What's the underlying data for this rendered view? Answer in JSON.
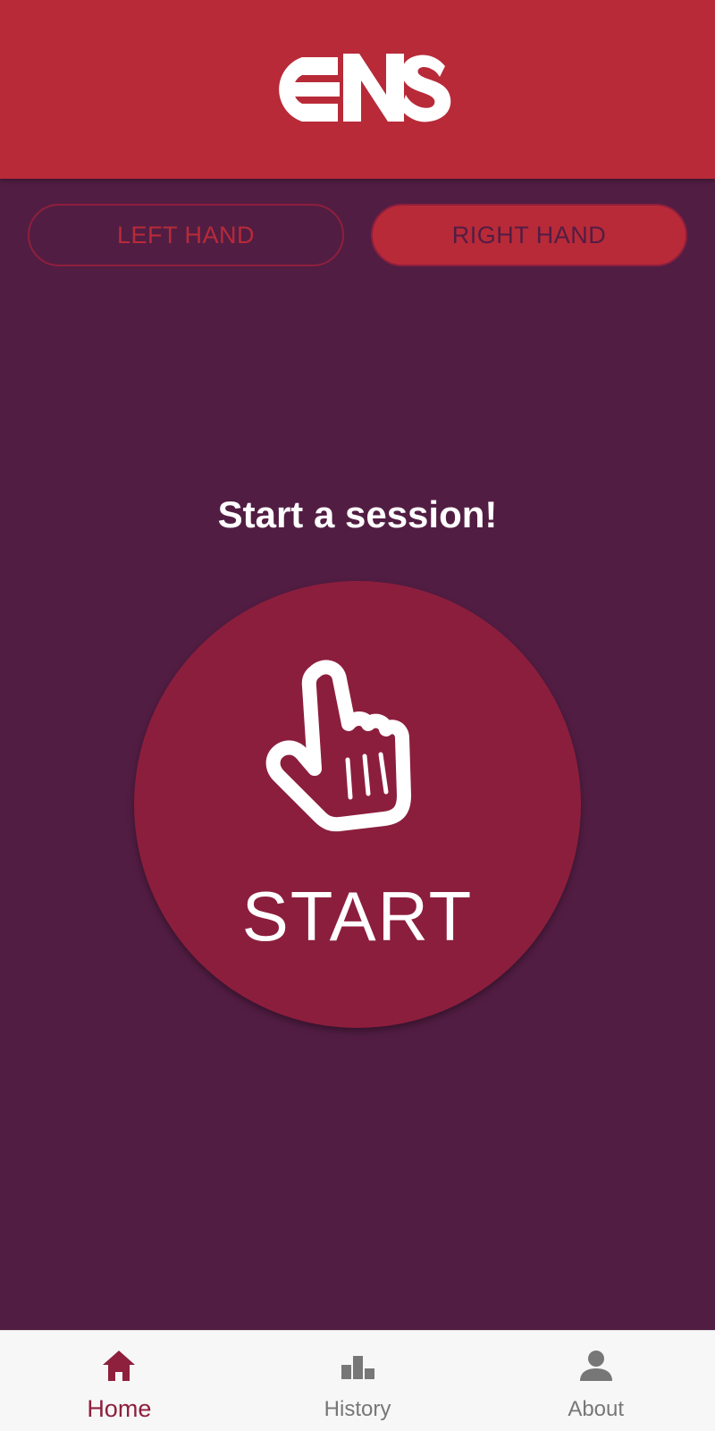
{
  "app": {
    "logo_text": "CNS"
  },
  "colors": {
    "header": "#B82A38",
    "background": "#521D43",
    "accent": "#8C1E3D",
    "nav_background": "#F7F7F7",
    "nav_active": "#8E1F3D",
    "nav_inactive": "#777777"
  },
  "hand_toggle": {
    "left_label": "LEFT HAND",
    "right_label": "RIGHT HAND",
    "selected": "RIGHT HAND"
  },
  "main": {
    "prompt": "Start a session!",
    "start_label": "START",
    "start_icon": "pointing-hand-icon"
  },
  "nav": {
    "items": [
      {
        "label": "Home",
        "icon": "home-icon",
        "active": true
      },
      {
        "label": "History",
        "icon": "bar-chart-icon",
        "active": false
      },
      {
        "label": "About",
        "icon": "person-icon",
        "active": false
      }
    ]
  }
}
